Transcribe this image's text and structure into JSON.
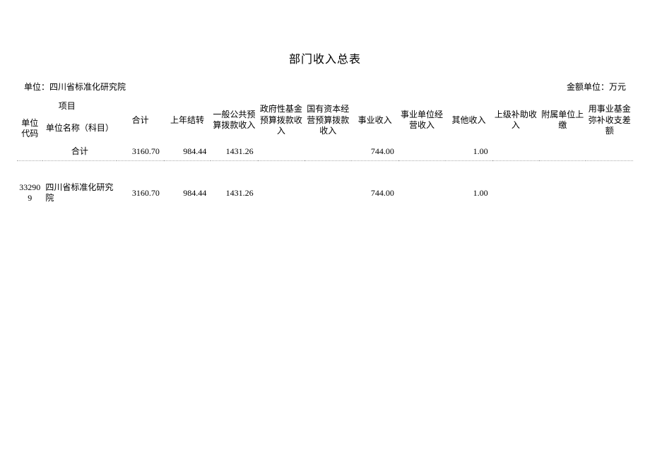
{
  "title": "部门收入总表",
  "meta": {
    "unit_label": "单位：四川省标准化研究院",
    "amount_unit_label": "金额单位：万元"
  },
  "headers": {
    "group_project": "项目",
    "unit_code": "单位代码",
    "unit_name": "单位名称（科目）",
    "total": "合计",
    "prev_carry": "上年结转",
    "general_public": "一般公共预算拨款收入",
    "gov_fund": "政府性基金预算拨款收入",
    "state_capital": "国有资本经营预算拨款收入",
    "business_income": "事业收入",
    "institution_oper": "事业单位经营收入",
    "other_income": "其他收入",
    "upper_subsidy": "上级补助收入",
    "affiliated_payin": "附属单位上缴",
    "fund_balance": "用事业基金弥补收支差额"
  },
  "chart_data": {
    "type": "table",
    "columns": [
      "单位代码",
      "单位名称（科目）",
      "合计",
      "上年结转",
      "一般公共预算拨款收入",
      "政府性基金预算拨款收入",
      "国有资本经营预算拨款收入",
      "事业收入",
      "事业单位经营收入",
      "其他收入",
      "上级补助收入",
      "附属单位上缴",
      "用事业基金弥补收支差额"
    ],
    "rows": [
      {
        "code": "",
        "name": "合计",
        "total": "3160.70",
        "prev": "984.44",
        "gen": "1431.26",
        "gov": "",
        "state": "",
        "biz": "744.00",
        "inst": "",
        "other": "1.00",
        "upper": "",
        "aff": "",
        "bal": ""
      },
      {
        "code": "332909",
        "name": "四川省标准化研究院",
        "total": "3160.70",
        "prev": "984.44",
        "gen": "1431.26",
        "gov": "",
        "state": "",
        "biz": "744.00",
        "inst": "",
        "other": "1.00",
        "upper": "",
        "aff": "",
        "bal": ""
      }
    ]
  }
}
